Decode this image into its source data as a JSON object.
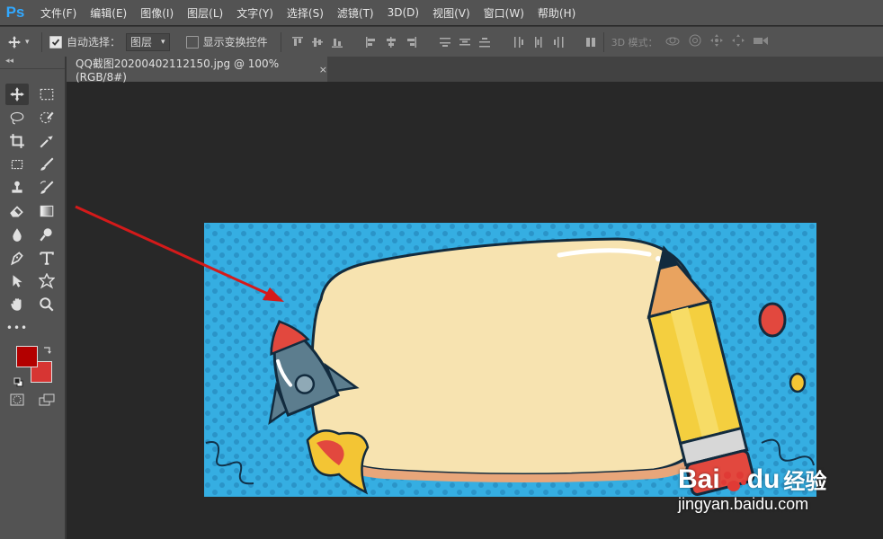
{
  "app": {
    "logo": "Ps"
  },
  "menu": [
    "文件(F)",
    "编辑(E)",
    "图像(I)",
    "图层(L)",
    "文字(Y)",
    "选择(S)",
    "滤镜(T)",
    "3D(D)",
    "视图(V)",
    "窗口(W)",
    "帮助(H)"
  ],
  "options": {
    "auto_select_label": "自动选择：",
    "auto_select_value": "图层",
    "show_transform_label": "显示变换控件",
    "mode_3d_label": "3D 模式："
  },
  "document": {
    "tab_title": "QQ截图20200402112150.jpg @ 100%(RGB/8#)",
    "close": "×"
  },
  "toolbar": {
    "top_marker": "◂◂",
    "dots": "•••"
  },
  "colors": {
    "foreground": "#b30000",
    "background": "#d73533",
    "accent_blue": "#31a8ff",
    "arrow": "#d41a1a"
  },
  "watermark": {
    "brand": "Bai",
    "brand2": "du",
    "suffix": "经验",
    "url": "jingyan.baidu.com"
  }
}
